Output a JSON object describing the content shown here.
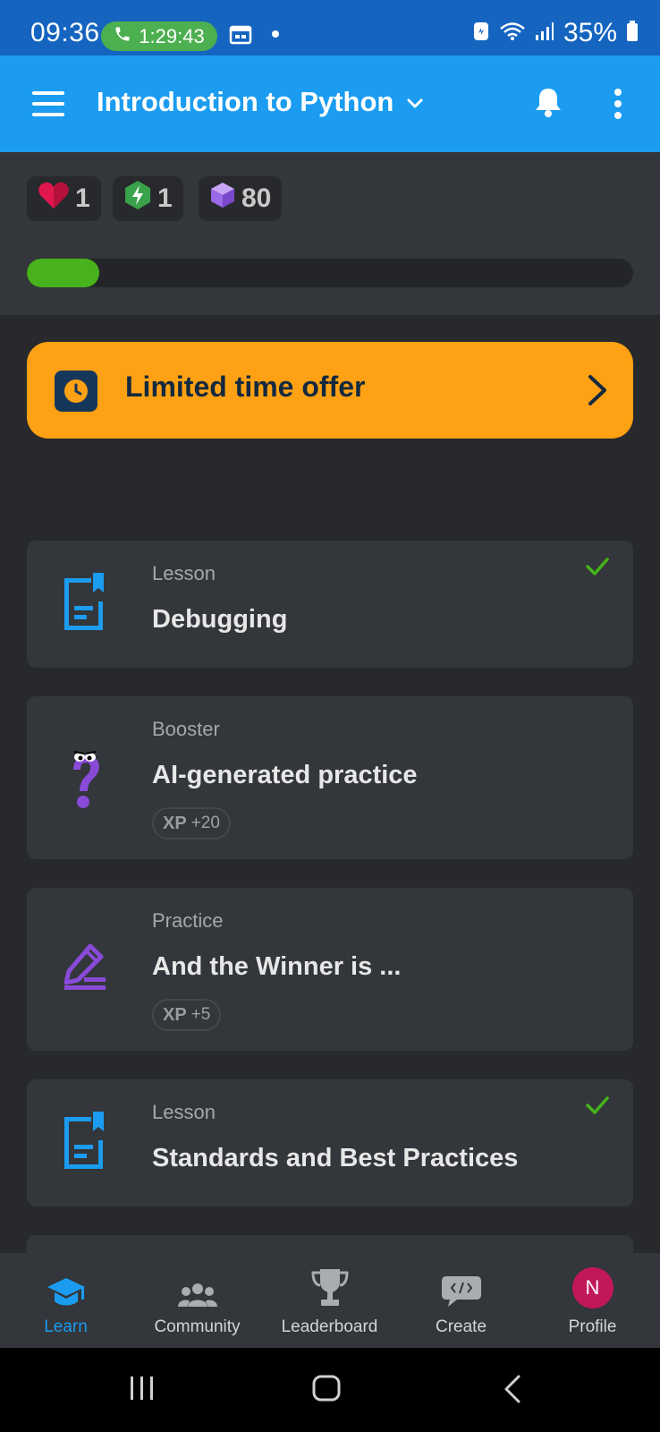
{
  "status_bar": {
    "time": "09:36",
    "call_timer": "1:29:43",
    "battery": "35%"
  },
  "app_bar": {
    "title": "Introduction to Python"
  },
  "stats": {
    "hearts": "1",
    "energy": "1",
    "gems": "80",
    "progress_fraction": 0.12
  },
  "offer": {
    "label": "Limited time offer"
  },
  "items": [
    {
      "type": "Lesson",
      "title": "Debugging",
      "completed": true,
      "icon": "lesson-icon"
    },
    {
      "type": "Booster",
      "title": "AI-generated practice",
      "xp_label": "XP",
      "xp": "+20",
      "icon": "question-mascot-icon"
    },
    {
      "type": "Practice",
      "title": "And the Winner is ...",
      "xp_label": "XP",
      "xp": "+5",
      "icon": "pencil-icon"
    },
    {
      "type": "Lesson",
      "title": "Standards and Best Practices",
      "completed": true,
      "icon": "lesson-icon"
    }
  ],
  "bottom_nav": [
    {
      "label": "Learn",
      "icon": "graduation-cap-icon",
      "active": true
    },
    {
      "label": "Community",
      "icon": "people-icon"
    },
    {
      "label": "Leaderboard",
      "icon": "trophy-icon"
    },
    {
      "label": "Create",
      "icon": "code-bubble-icon"
    },
    {
      "label": "Profile",
      "icon": "avatar",
      "initial": "N"
    }
  ],
  "colors": {
    "primary": "#1b9cf0",
    "offer": "#ffa114",
    "progress": "#47b21b",
    "avatar": "#c1185b"
  }
}
